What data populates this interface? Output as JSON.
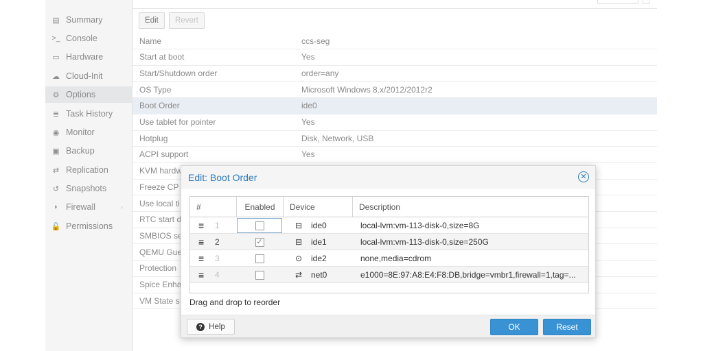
{
  "sidebar": {
    "items": [
      {
        "label": "Summary",
        "icon": "summary-icon",
        "glyph": "▤"
      },
      {
        "label": "Console",
        "icon": "console-icon",
        "glyph": ">_"
      },
      {
        "label": "Hardware",
        "icon": "monitor-icon",
        "glyph": "▭"
      },
      {
        "label": "Cloud-Init",
        "icon": "cloud-icon",
        "glyph": "☁"
      },
      {
        "label": "Options",
        "icon": "gear-icon",
        "glyph": "⚙"
      },
      {
        "label": "Task History",
        "icon": "list-icon",
        "glyph": "≣"
      },
      {
        "label": "Monitor",
        "icon": "eye-icon",
        "glyph": "◉"
      },
      {
        "label": "Backup",
        "icon": "floppy-icon",
        "glyph": "▣"
      },
      {
        "label": "Replication",
        "icon": "retweet-icon",
        "glyph": "⇄"
      },
      {
        "label": "Snapshots",
        "icon": "history-icon",
        "glyph": "↺"
      },
      {
        "label": "Firewall",
        "icon": "shield-icon",
        "glyph": "◗"
      },
      {
        "label": "Permissions",
        "icon": "unlock-icon",
        "glyph": "🔓"
      }
    ],
    "firewall_arrow": "›"
  },
  "toolbar": {
    "edit_label": "Edit",
    "revert_label": "Revert"
  },
  "options": {
    "rows": [
      {
        "key": "Name",
        "value": "ccs-seg"
      },
      {
        "key": "Start at boot",
        "value": "Yes"
      },
      {
        "key": "Start/Shutdown order",
        "value": "order=any"
      },
      {
        "key": "OS Type",
        "value": "Microsoft Windows 8.x/2012/2012r2"
      },
      {
        "key": "Boot Order",
        "value": "ide0"
      },
      {
        "key": "Use tablet for pointer",
        "value": "Yes"
      },
      {
        "key": "Hotplug",
        "value": "Disk, Network, USB"
      },
      {
        "key": "ACPI support",
        "value": "Yes"
      },
      {
        "key": "KVM hardw",
        "value": ""
      },
      {
        "key": "Freeze CP",
        "value": ""
      },
      {
        "key": "Use local ti",
        "value": ""
      },
      {
        "key": "RTC start d",
        "value": ""
      },
      {
        "key": "SMBIOS se",
        "value": ""
      },
      {
        "key": "QEMU Gue",
        "value": ""
      },
      {
        "key": "Protection",
        "value": ""
      },
      {
        "key": "Spice Enha",
        "value": ""
      },
      {
        "key": "VM State s",
        "value": ""
      }
    ]
  },
  "dialog": {
    "title": "Edit: Boot Order",
    "close_glyph": "✕",
    "columns": {
      "num": "#",
      "enabled": "Enabled",
      "device": "Device",
      "description": "Description"
    },
    "rows": [
      {
        "num": "1",
        "enabled": false,
        "device_icon": "hdd-icon",
        "device_glyph": "⊟",
        "device": "ide0",
        "description": "local-lvm:vm-113-disk-0,size=8G"
      },
      {
        "num": "2",
        "enabled": true,
        "device_icon": "hdd-icon",
        "device_glyph": "⊟",
        "device": "ide1",
        "description": "local-lvm:vm-113-disk-0,size=250G"
      },
      {
        "num": "3",
        "enabled": false,
        "device_icon": "cdrom-icon",
        "device_glyph": "⊙",
        "device": "ide2",
        "description": "none,media=cdrom"
      },
      {
        "num": "4",
        "enabled": false,
        "device_icon": "exchange-icon",
        "device_glyph": "⇄",
        "device": "net0",
        "description": "e1000=8E:97:A8:E4:F8:DB,bridge=vmbr1,firewall=1,tag=..."
      }
    ],
    "handle_glyph": "≡",
    "check_glyph": "✓",
    "hint": "Drag and drop to reorder",
    "help_label": "Help",
    "help_glyph": "?",
    "ok_label": "OK",
    "reset_label": "Reset"
  }
}
